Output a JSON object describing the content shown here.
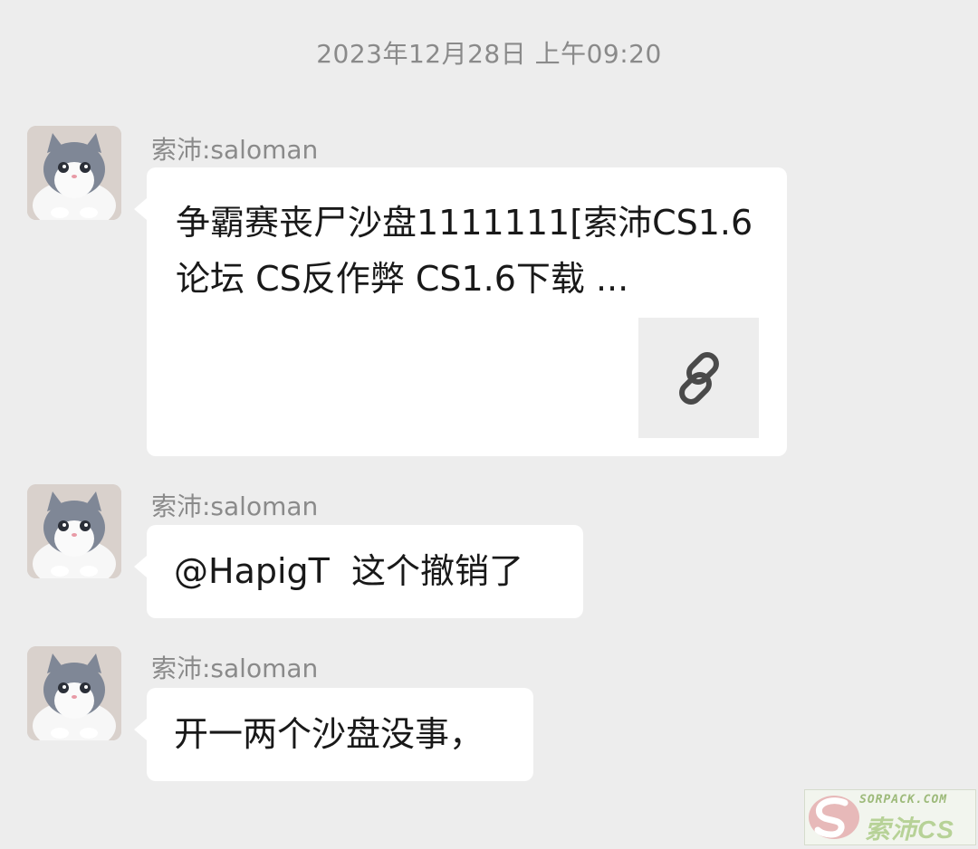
{
  "timestamp": "2023年12月28日 上午09:20",
  "messages": [
    {
      "sender": "索沛:saloman",
      "type": "link",
      "title": "争霸赛丧尸沙盘1111111[索沛CS1.6论坛 CS反作弊 CS1.6下载 ...",
      "thumb_icon": "link-icon"
    },
    {
      "sender": "索沛:saloman",
      "type": "text",
      "text": "@HapigT  这个撤销了"
    },
    {
      "sender": "索沛:saloman",
      "type": "text",
      "text": "开一两个沙盘没事，"
    }
  ],
  "watermark": {
    "site": "SORPACK.COM",
    "brand": "索沛CS"
  },
  "colors": {
    "background": "#ededed",
    "bubble": "#ffffff",
    "meta_text": "#8a8a8a",
    "message_text": "#191919"
  }
}
